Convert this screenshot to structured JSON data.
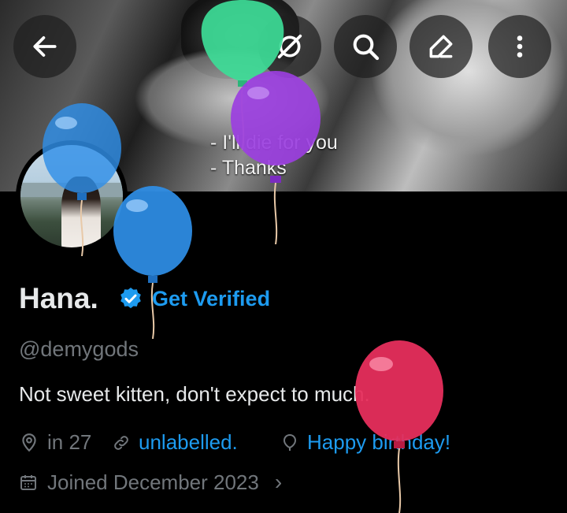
{
  "header": {
    "banner_caption_line1": "- I'll die for you",
    "banner_caption_line2": "- Thanks",
    "buttons": [
      "back-icon",
      "no-signal-icon",
      "search-icon",
      "edit-icon",
      "more-icon"
    ]
  },
  "profile": {
    "name": "Hana.",
    "get_verified": "Get Verified",
    "handle": "@demygods",
    "bio": "Not sweet kitten, don't expect to much.",
    "location": "in 27",
    "website": "unlabelled.",
    "birthday": "Happy birthday!",
    "joined": "Joined December 2023",
    "joined_chevron": "›"
  },
  "colors": {
    "accent": "#1d9bf0",
    "secondary_text": "#71767b",
    "primary_text": "#e7e9ea",
    "balloon_green": "#3ddc97",
    "balloon_purple": "#9b3fe0",
    "balloon_blue": "#2f8fe8",
    "balloon_red": "#e62e5c"
  }
}
